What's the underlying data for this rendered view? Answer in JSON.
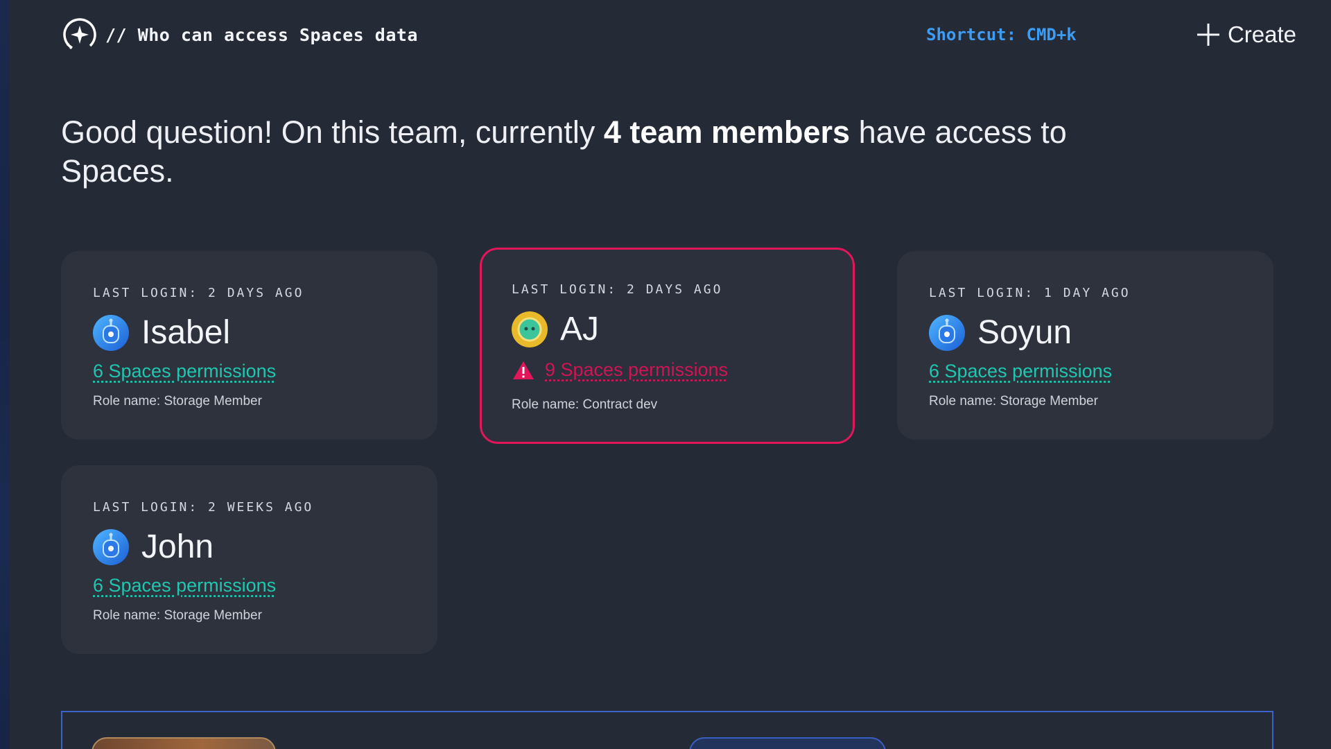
{
  "header": {
    "title": "// Who can access Spaces data",
    "shortcut": "Shortcut: CMD+k",
    "create_label": "Create"
  },
  "headline": {
    "prefix": "Good question! On this team, currently ",
    "bold": "4 team members",
    "suffix": " have access to Spaces."
  },
  "members": [
    {
      "last_login": "LAST LOGIN: 2 DAYS AGO",
      "name": "Isabel",
      "permissions": "6 Spaces permissions",
      "role": "Role name: Storage Member",
      "avatar": "robot-blue-icon",
      "alert": false
    },
    {
      "last_login": "LAST LOGIN: 2 DAYS AGO",
      "name": "AJ",
      "permissions": "9 Spaces permissions",
      "role": "Role name: Contract dev",
      "avatar": "robot-yellow-icon",
      "alert": true
    },
    {
      "last_login": "LAST LOGIN: 1 DAY AGO",
      "name": "Soyun",
      "permissions": "6 Spaces permissions",
      "role": "Role name: Storage Member",
      "avatar": "robot-blue-icon",
      "alert": false
    },
    {
      "last_login": "LAST LOGIN: 2 WEEKS AGO",
      "name": "John",
      "permissions": "6 Spaces permissions",
      "role": "Role name: Storage Member",
      "avatar": "robot-blue-icon",
      "alert": false
    }
  ],
  "colors": {
    "background": "#242a36",
    "card": "#2d323d",
    "accent_link": "#1fc7b0",
    "alert": "#e3165b",
    "shortcut": "#3d9df5"
  }
}
